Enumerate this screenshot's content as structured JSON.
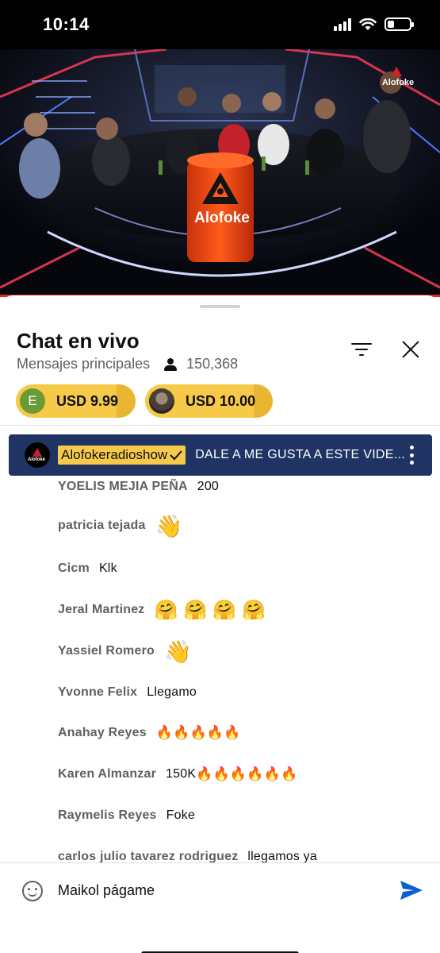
{
  "status_bar": {
    "time": "10:14"
  },
  "video": {
    "channel_logo": "Alofoke",
    "watermark": "Alofoke"
  },
  "chat": {
    "title": "Chat en vivo",
    "mode": "Mensajes principales",
    "viewer_count": "150,368",
    "icons": [
      "person-icon",
      "filter-icon",
      "close-icon"
    ]
  },
  "tips": [
    {
      "avatar_letter": "E",
      "amount": "USD 9.99",
      "avatar_color": "#6b9b37"
    },
    {
      "avatar_letter": "",
      "amount": "USD 10.00",
      "avatar_color": "#4a3f36"
    }
  ],
  "pinned": {
    "author": "Alofokeradioshow",
    "message": "DALE A ME GUSTA A ESTE VIDE...",
    "background": "#203464",
    "author_highlight": "#f7c948"
  },
  "messages": [
    {
      "author": "YOELIS MEJIA PEÑA",
      "text": "200",
      "emoji": ""
    },
    {
      "author": "patricia tejada",
      "text": "",
      "emoji": "👋"
    },
    {
      "author": "Cicm",
      "text": "Klk",
      "emoji": ""
    },
    {
      "author": "Jeral Martinez",
      "text": "",
      "emoji": "🤗 🤗 🤗 🤗"
    },
    {
      "author": "Yassiel Romero",
      "text": "",
      "emoji": "👋"
    },
    {
      "author": "Yvonne Felix",
      "text": "Llegamo",
      "emoji": ""
    },
    {
      "author": "Anahay Reyes",
      "text": "",
      "emoji": "🔥🔥🔥🔥🔥"
    },
    {
      "author": "Karen Almanzar",
      "text": "150K",
      "emoji": "🔥🔥🔥🔥🔥🔥"
    },
    {
      "author": "Raymelis Reyes",
      "text": "Foke",
      "emoji": ""
    },
    {
      "author": "carlos julio tavarez rodriguez",
      "text": "llegamos ya",
      "emoji": ""
    }
  ],
  "input": {
    "value": "Maikol págame",
    "accent": "#065fd4"
  }
}
